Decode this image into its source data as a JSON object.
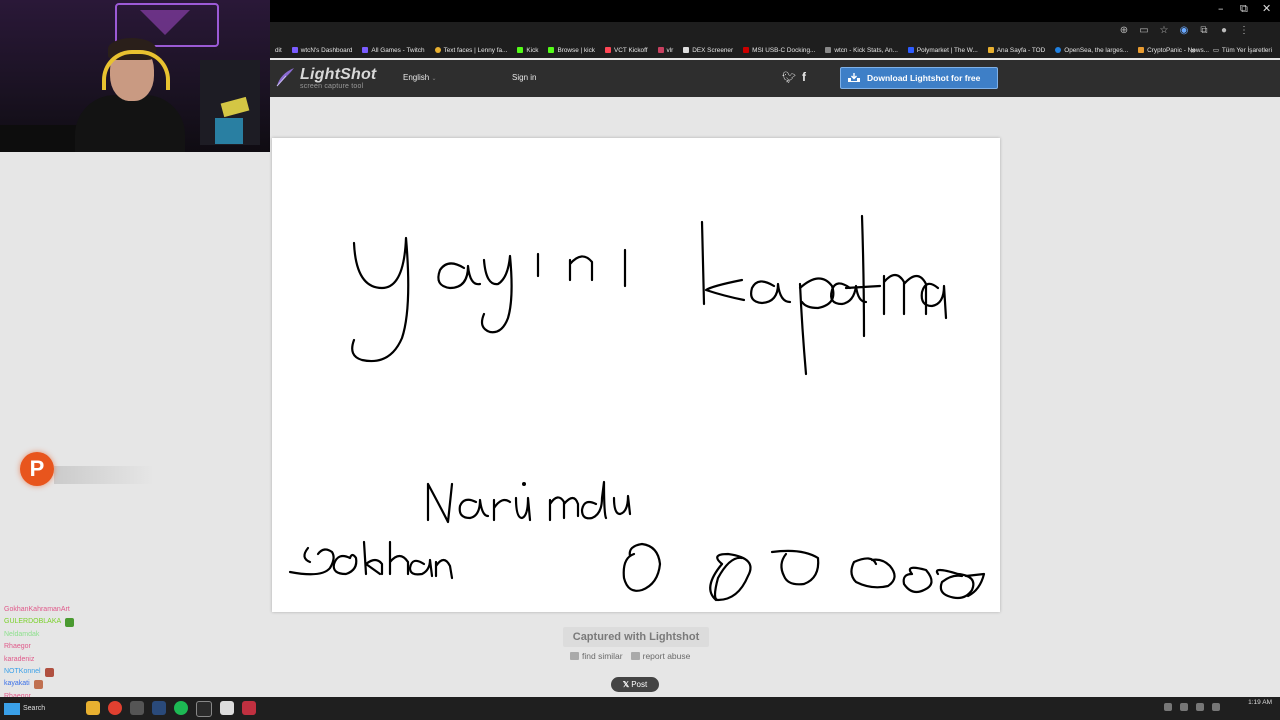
{
  "window": {
    "minimize": "–",
    "maximize": "⧉",
    "close": "✕"
  },
  "bookmarks": {
    "items": [
      {
        "label": "dit"
      },
      {
        "label": "wtcN's Dashboard"
      },
      {
        "label": "All Games - Twitch"
      },
      {
        "label": "Text faces | Lenny fa..."
      },
      {
        "label": "Kick"
      },
      {
        "label": "Browse | kick"
      },
      {
        "label": "VCT Kickoff"
      },
      {
        "label": "vlr"
      },
      {
        "label": "DEX Screener"
      },
      {
        "label": "MSI USB-C Docking..."
      },
      {
        "label": "wtcn - Kick Stats, An..."
      },
      {
        "label": "Polymarket | The W..."
      },
      {
        "label": "Ana Sayfa - TOD"
      },
      {
        "label": "OpenSea, the larges..."
      },
      {
        "label": "CryptoPanic - News..."
      }
    ],
    "overflow": "»",
    "all_bookmarks": "Tüm Yer İşaretleri"
  },
  "lightshot": {
    "logo": "LightShot",
    "tagline": "screen capture tool",
    "language": "English",
    "signin": "Sign in",
    "download": "Download Lightshot for free",
    "captured": "Captured with Lightshot",
    "find_similar": "find similar",
    "report_abuse": "report abuse",
    "x_post": "Post"
  },
  "chat": {
    "messages": [
      {
        "user": "GokhanKahramanArt",
        "color": "#e05a8a",
        "text": ""
      },
      {
        "user": "GULERDOBLAKA",
        "color": "#7ad12a",
        "text": ""
      },
      {
        "user": "Neldamdak",
        "color": "#8de08d",
        "text": ""
      },
      {
        "user": "Rhaegor",
        "color": "#e05a8a",
        "text": ""
      },
      {
        "user": "karadeniz",
        "color": "#e05a8a",
        "text": ""
      },
      {
        "user": "NOTKonnel",
        "color": "#3aa0e8",
        "text": ""
      },
      {
        "user": "kayakati",
        "color": "#3a70e8",
        "text": ""
      },
      {
        "user": "Rhaegor",
        "color": "#e05a8a",
        "text": ""
      }
    ]
  },
  "pbadge": "P",
  "taskbar": {
    "search": "Search",
    "time": "1:19 AM",
    "date": ""
  },
  "colors": {
    "download_button": "#3e7fc7",
    "header_bg": "#2e2e2e",
    "p_badge": "#e8551d"
  }
}
